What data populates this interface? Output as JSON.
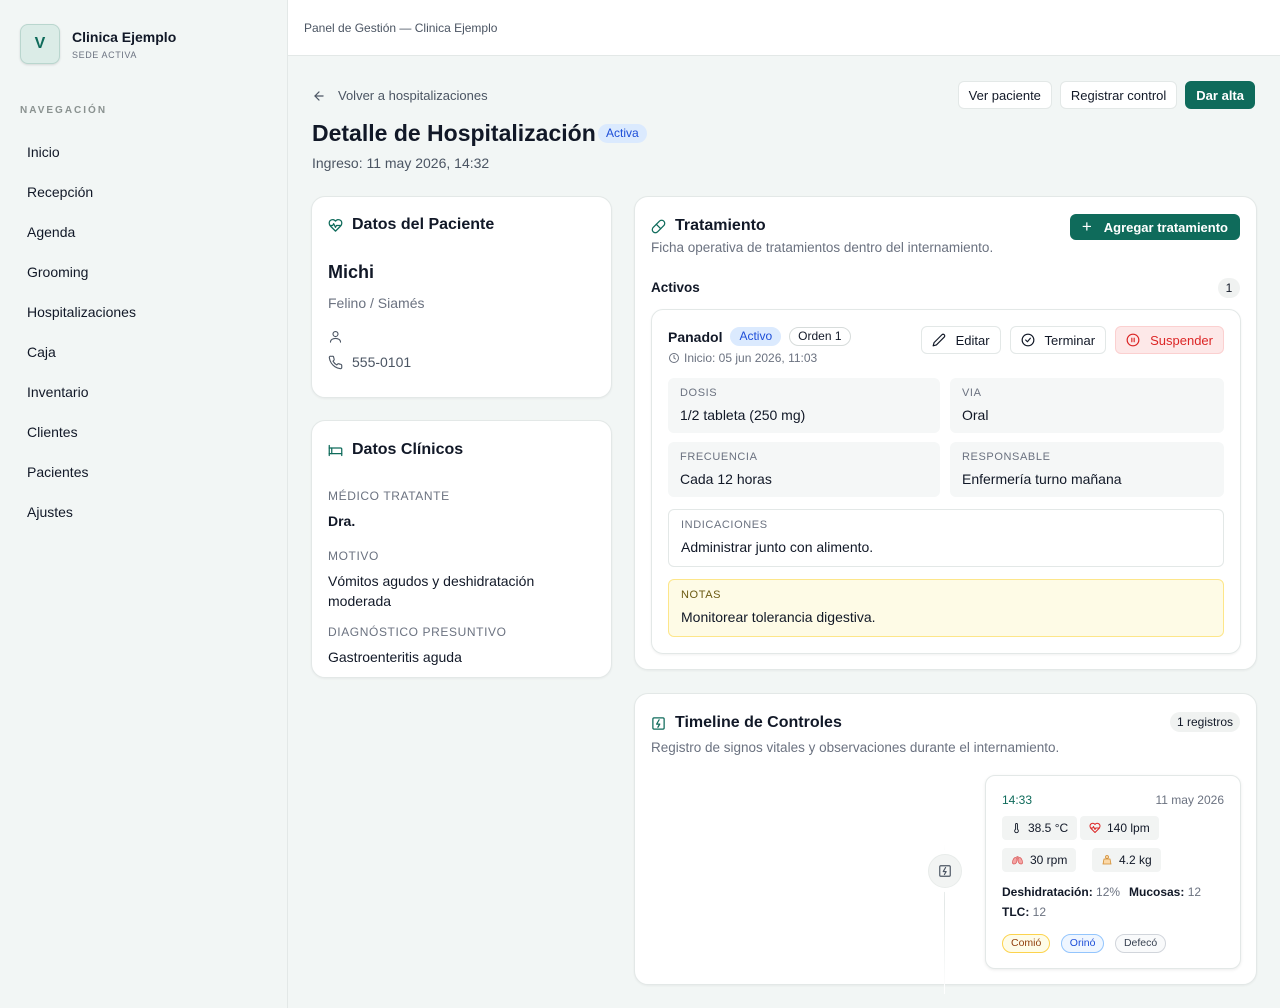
{
  "brand": {
    "initial": "V",
    "name": "Clinica Ejemplo",
    "subtitle": "SEDE ACTIVA"
  },
  "nav": {
    "heading": "NAVEGACIÓN",
    "items": [
      "Inicio",
      "Recepción",
      "Agenda",
      "Grooming",
      "Hospitalizaciones",
      "Caja",
      "Inventario",
      "Clientes",
      "Pacientes",
      "Ajustes"
    ]
  },
  "topbar": {
    "title": "Panel de Gestión — Clinica Ejemplo"
  },
  "header": {
    "back_label": "Volver a hospitalizaciones",
    "title": "Detalle de Hospitalización",
    "status": "Activa",
    "admission": "Ingreso: 11 may 2026, 14:32",
    "actions": {
      "view_patient": "Ver paciente",
      "register_control": "Registrar control",
      "discharge": "Dar alta"
    }
  },
  "patient": {
    "card_title": "Datos del Paciente",
    "name": "Michi",
    "species": "Felino / Siamés",
    "owner": "",
    "phone": "555-0101"
  },
  "clinical": {
    "card_title": "Datos Clínicos",
    "doctor_label": "MÉDICO TRATANTE",
    "doctor": "Dra.",
    "reason_label": "MOTIVO",
    "reason": "Vómitos agudos y deshidratación moderada",
    "diagnosis_label": "DIAGNÓSTICO PRESUNTIVO",
    "diagnosis": "Gastroenteritis aguda"
  },
  "treatment": {
    "card_title": "Tratamiento",
    "description": "Ficha operativa de tratamientos dentro del internamiento.",
    "add_label": "Agregar tratamiento",
    "active_label": "Activos",
    "active_count": "1",
    "item": {
      "name": "Panadol",
      "status": "Activo",
      "order": "Orden 1",
      "start": "Inicio: 05 jun 2026, 11:03",
      "edit_label": "Editar",
      "finish_label": "Terminar",
      "suspend_label": "Suspender",
      "dose_label": "DOSIS",
      "dose": "1/2 tableta (250 mg)",
      "route_label": "VIA",
      "route": "Oral",
      "frequency_label": "FRECUENCIA",
      "frequency": "Cada 12 horas",
      "responsible_label": "RESPONSABLE",
      "responsible": "Enfermería turno mañana",
      "indications_label": "INDICACIONES",
      "indications": "Administrar junto con alimento.",
      "notes_label": "NOTAS",
      "notes": "Monitorear tolerancia digestiva."
    }
  },
  "timeline": {
    "card_title": "Timeline de Controles",
    "count": "1 registros",
    "description": "Registro de signos vitales y observaciones durante el internamiento.",
    "entry": {
      "time": "14:33",
      "date": "11 may 2026",
      "temperature": "38.5 °C",
      "heart_rate": "140 lpm",
      "resp_rate": "30 rpm",
      "weight": "4.2 kg",
      "dehydration_label": "Deshidratación:",
      "dehydration": "12%",
      "mucosa_label": "Mucosas:",
      "mucosa": "12",
      "tlc_label": "TLC:",
      "tlc": "12",
      "tags": [
        "Comió",
        "Orinó",
        "Defecó"
      ]
    }
  },
  "colors": {
    "primary": "#0f6b5b",
    "active_badge_bg": "#dbeafe",
    "active_badge_text": "#1d4ed8",
    "danger": "#dc2626",
    "notes_bg": "#fefbe6"
  }
}
